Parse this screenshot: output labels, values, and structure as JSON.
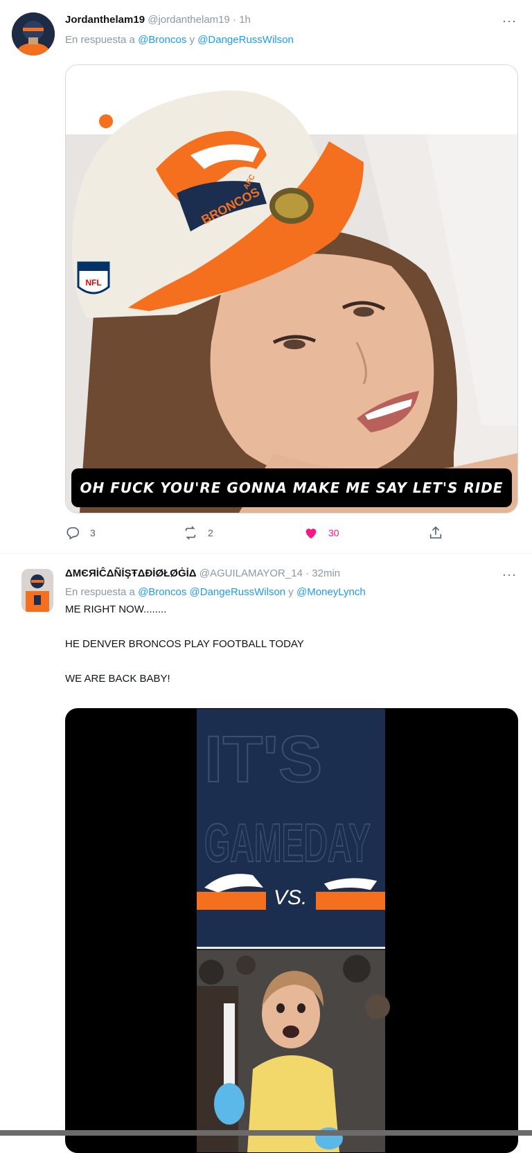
{
  "tweets": [
    {
      "display_name": "Jordanthelam19",
      "handle": "@jordanthelam19",
      "separator": " · ",
      "time": "1h",
      "reply_prefix": "En respuesta a ",
      "reply_mention_1": "@Broncos",
      "reply_joiner": " y ",
      "reply_mention_2": "@DangeRussWilson",
      "more": "···",
      "caption": "OH FUCK YOU'RE GONNA MAKE ME SAY LET'S RIDE",
      "hat_text": "BRONCOS",
      "hat_badge": "AFC",
      "hat_nfl": "NFL",
      "stats": {
        "replies": "3",
        "retweets": "2",
        "likes": "30"
      }
    },
    {
      "display_name": "ΔMЄЯİĈΔÑİŞŦΔÐİØŁØĠİΔ",
      "handle": "@AGUILAMAYOR_14",
      "separator": " · ",
      "time": "32min",
      "reply_prefix": "En respuesta a ",
      "reply_mention_1": "@Broncos",
      "reply_space": " ",
      "reply_mention_2": "@DangeRussWilson",
      "reply_joiner": " y ",
      "reply_mention_3": "@MoneyLynch",
      "more": "···",
      "text_line_1": "ME RIGHT NOW........",
      "text_line_2": "HE DENVER BRONCOS PLAY FOOTBALL TODAY",
      "text_line_3": "WE ARE BACK BABY!",
      "gameday_line_1": "IT'S",
      "gameday_line_2": "GAMEDAY",
      "vs_label": "VS."
    }
  ],
  "colors": {
    "accent": "#1d9bf0",
    "like": "#f91880",
    "muted": "#536471",
    "broncos_orange": "#f4701f",
    "broncos_navy": "#1c2e4f"
  }
}
